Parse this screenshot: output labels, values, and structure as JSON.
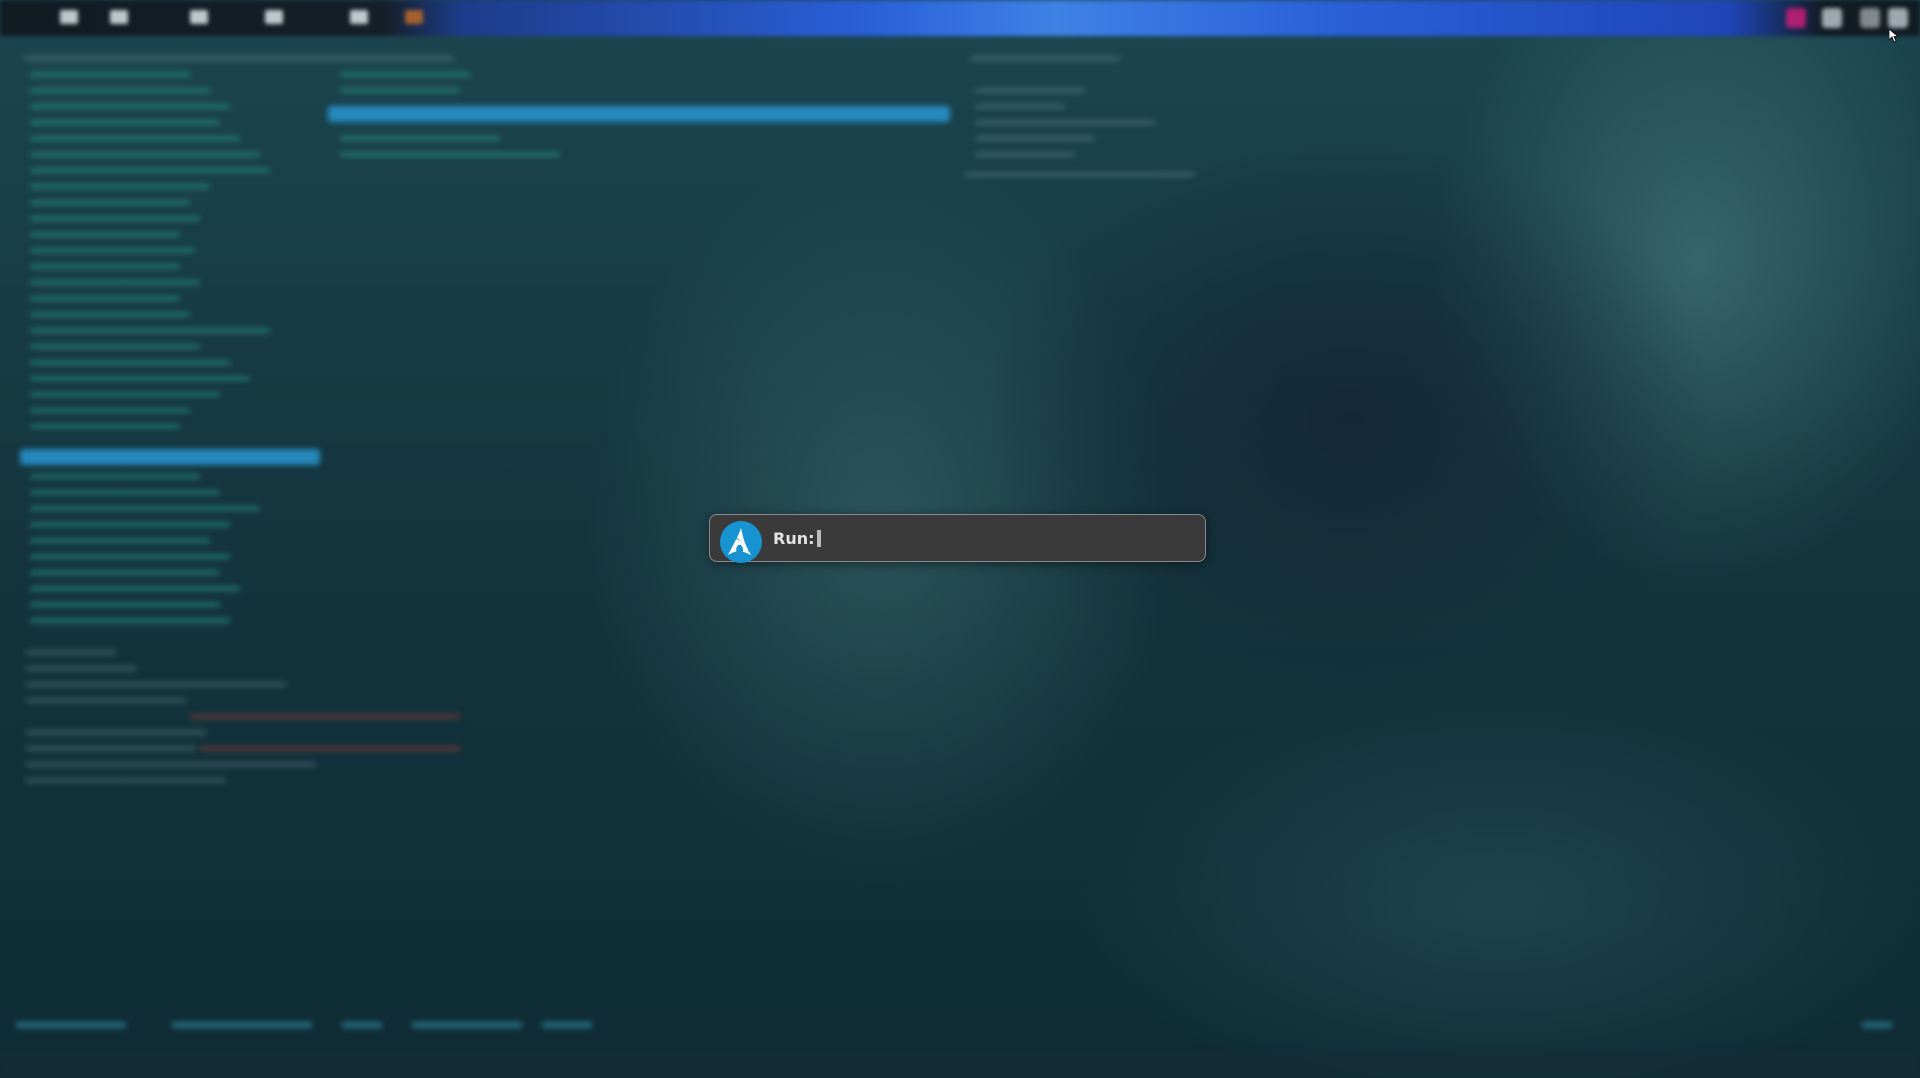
{
  "run_dialog": {
    "prompt_label": "Run:",
    "input_value": "",
    "logo_icon": "arch-linux-logo-icon",
    "logo_color": "#1793d1"
  },
  "colors": {
    "accent_highlight": "#2896d2",
    "terminal_text": "#28968c",
    "dialog_background": "#3a3a3a",
    "dialog_border": "#8a8a8a"
  }
}
